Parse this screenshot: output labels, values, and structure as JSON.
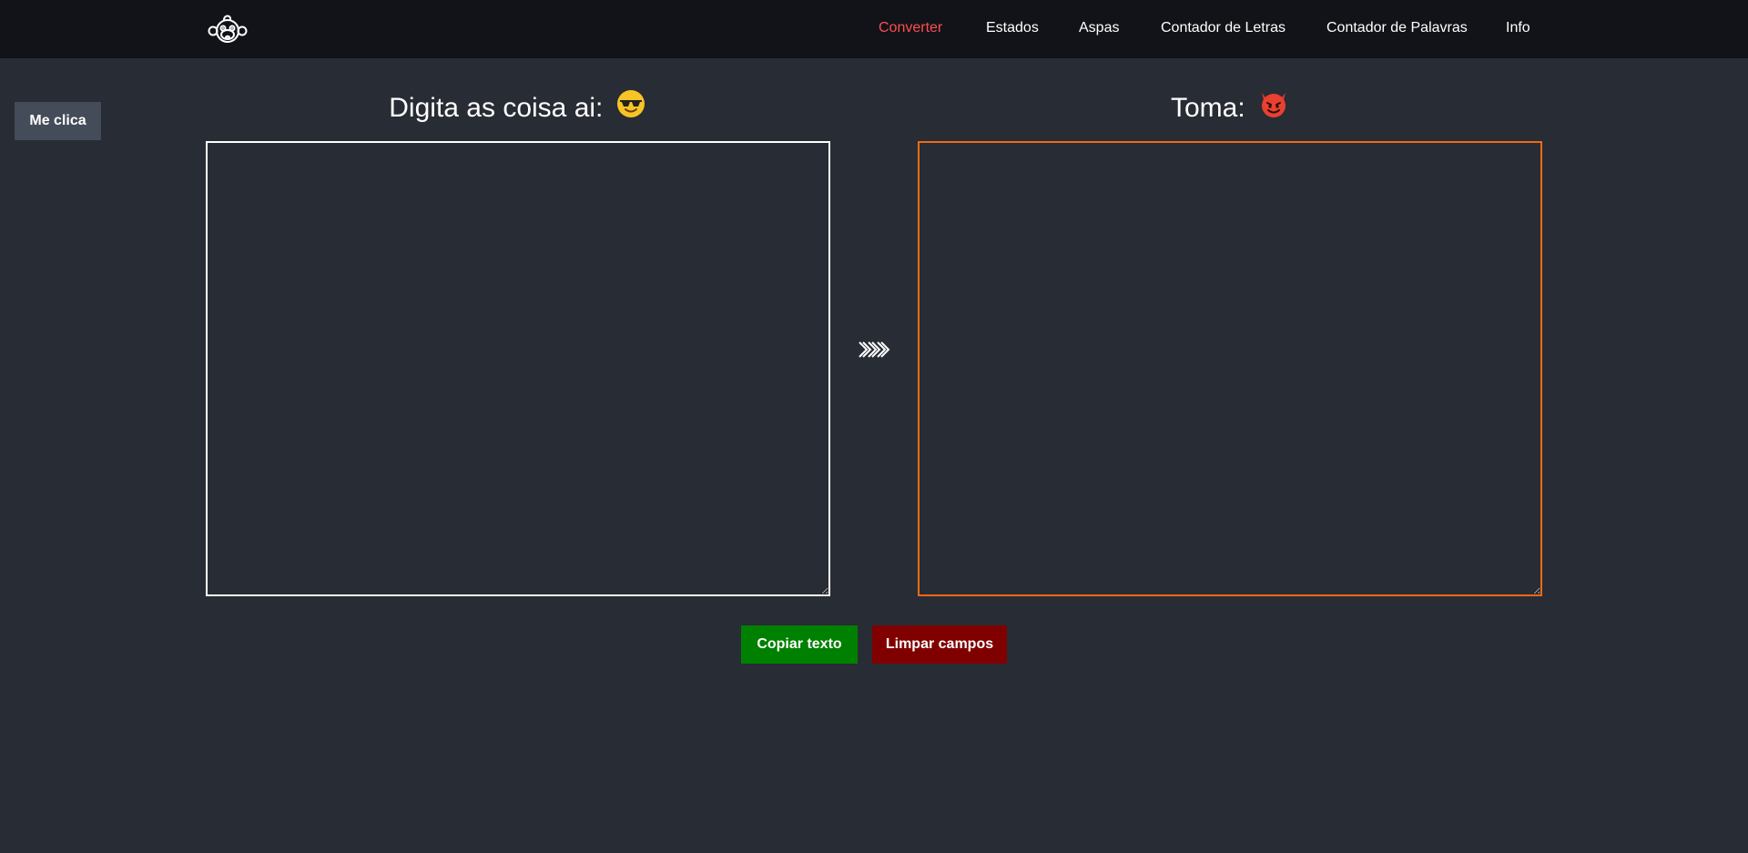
{
  "nav": {
    "logo_icon": "monkey-icon",
    "links": [
      {
        "label": "Converter",
        "active": true
      },
      {
        "label": "Estados",
        "active": false
      },
      {
        "label": "Aspas",
        "active": false
      },
      {
        "label": "Contador de Letras",
        "active": false
      },
      {
        "label": "Contador de Palavras",
        "active": false
      },
      {
        "label": "Info",
        "active": false
      }
    ],
    "active_color": "#ff4d4f"
  },
  "side_button": {
    "label": "Me clica"
  },
  "input_panel": {
    "title": "Digita as coisa ai:",
    "emoji": "😎",
    "value": "",
    "border_color": "#ffffff"
  },
  "output_panel": {
    "title": "Toma:",
    "emoji": "😈",
    "value": "",
    "border_color": "#f06a13"
  },
  "arrow_icon": "triple-chevron-right-icon",
  "buttons": {
    "copy_label": "Copiar texto",
    "copy_color": "#008000",
    "clear_label": "Limpar campos",
    "clear_color": "#800000"
  },
  "colors": {
    "background": "#282c34",
    "navbar": "#111318"
  }
}
